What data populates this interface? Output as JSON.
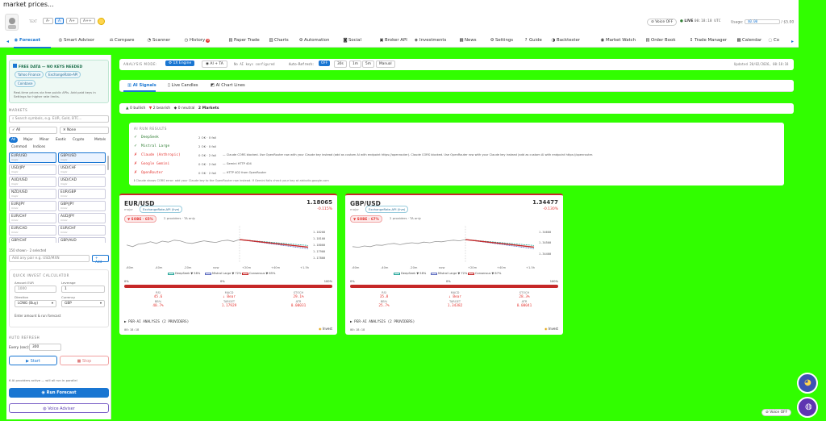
{
  "topbar": {
    "title": "market prices..."
  },
  "header": {
    "fs_label": "TEXT",
    "fs": [
      "A-",
      "A",
      "A+",
      "A++"
    ],
    "voice": "Voice OFF",
    "live": "LIVE",
    "clock": "00:18:18 UTC",
    "usage_label": "Usage:",
    "usage_value": "$0.00",
    "usage_limit": "/ $5.00"
  },
  "nav": {
    "tabs": [
      {
        "l": "Forecast",
        "i": "◉"
      },
      {
        "l": "Smart Advisor",
        "i": "◎"
      },
      {
        "l": "Compare",
        "i": "⚖"
      },
      {
        "l": "Scanner",
        "i": "◔"
      },
      {
        "l": "History",
        "i": "◷",
        "b": "0"
      },
      {
        "l": "Paper Trade",
        "i": "▤"
      },
      {
        "l": "Charts",
        "i": "▥"
      },
      {
        "l": "Automation",
        "i": "⚙"
      },
      {
        "l": "Social",
        "i": "◙"
      },
      {
        "l": "Broker API",
        "i": "▣"
      },
      {
        "l": "Investments",
        "i": "◈"
      },
      {
        "l": "News",
        "i": "▦"
      },
      {
        "l": "Settings",
        "i": "⚙"
      },
      {
        "l": "Guide",
        "i": "?"
      },
      {
        "l": "Backtester",
        "i": "◑"
      },
      {
        "l": "Market Watch",
        "i": "◉"
      },
      {
        "l": "Order Book",
        "i": "▤"
      },
      {
        "l": "Trade Manager",
        "i": "↕"
      },
      {
        "l": "Calendar",
        "i": "▦"
      },
      {
        "l": "Co",
        "i": "◌"
      }
    ]
  },
  "sidebar": {
    "free_title": "FREE DATA — NO KEYS NEEDED",
    "chips": [
      "Yahoo Finance",
      "ExchangeRate-API",
      "Coinbase"
    ],
    "free_note": "Real-time prices via free public APIs. Add paid keys in Settings for higher rate limits.",
    "markets_label": "MARKETS",
    "search_ph": "Search symbols, e.g. EUR, Gold, BTC...",
    "all": "All",
    "none": "None",
    "cats": [
      "All",
      "Major",
      "Minor",
      "Exotic",
      "Crypto",
      "Metals",
      "Commod",
      "Indices"
    ],
    "pairs": [
      [
        "EUR/USD",
        "major"
      ],
      [
        "GBP/USD",
        "major"
      ],
      [
        "USD/JPY",
        "major"
      ],
      [
        "USD/CHF",
        "major"
      ],
      [
        "AUD/USD",
        "major"
      ],
      [
        "USD/CAD",
        "major"
      ],
      [
        "NZD/USD",
        "major"
      ],
      [
        "EUR/GBP",
        "minor"
      ],
      [
        "EUR/JPY",
        "minor"
      ],
      [
        "GBP/JPY",
        "minor"
      ],
      [
        "EUR/CHF",
        "minor"
      ],
      [
        "AUD/JPY",
        "minor"
      ],
      [
        "EUR/CAD",
        "minor"
      ],
      [
        "EUR/CHF",
        "minor"
      ],
      [
        "GBP/CHF",
        "minor"
      ],
      [
        "GBP/AUD",
        "minor"
      ]
    ],
    "count": "150 shown · 2 selected",
    "add_ph": "Add any pair e.g. USD/MXN",
    "add_btn": "+ Add",
    "calc_label": "QUICK INVEST CALCULATOR",
    "amount_label": "Amount EUR",
    "amount": "1000",
    "lev_label": "Leverage",
    "lev": "1",
    "dir_label": "Direction",
    "dir": "LONG (Buy)",
    "cur_label": "Currency",
    "cur": "GBP",
    "calc_note": "Enter amount & run forecast",
    "auto_label": "AUTO REFRESH",
    "every_label": "Every (sec):",
    "every": "300",
    "start": "▶ Start",
    "stop": "■ Stop",
    "providers_note": "6 AI providers active — will all run in parallel",
    "run": "Run Forecast",
    "voice": "Voice Adviser"
  },
  "analysis": {
    "mode_label": "ANALYSIS MODE:",
    "mode1": "1X Engine",
    "mode2": "AI + TA",
    "keys": "No AI keys configured",
    "auto_label": "Auto-Refresh:",
    "opts": [
      "OFF",
      "30s",
      "1m",
      "5m",
      "Manual"
    ],
    "updated": "Updated 20/02/2026, 00:18:18"
  },
  "subtabs": [
    "AI Signals",
    "Live Candles",
    "AI Chart Lines"
  ],
  "sentiment": {
    "bull": "0 bullish",
    "bear": "2 bearish",
    "neutral": "0 neutral",
    "markets": "2 Markets"
  },
  "runs": {
    "title": "AI RUN RESULTS",
    "rows": [
      [
        "✓",
        "DeepSeek",
        "2 OK · 0 fail",
        ""
      ],
      [
        "✓",
        "Mistral Large",
        "2 OK · 0 fail",
        ""
      ],
      [
        "✗",
        "Claude (Anthropic)",
        "0 OK · 2 fail",
        "— Claude CORS blocked. Use OpenRouter row with your Claude key instead (add as custom AI with endpoint https://openrouter). Claude CORS blocked. Use OpenRouter row with your Claude key instead (add as custom AI with endpoint https://openrouter."
      ],
      [
        "✗",
        "Google Gemini",
        "0 OK · 2 fail",
        "— Gemini HTTP 404"
      ],
      [
        "✗",
        "OpenRouter",
        "0 OK · 2 fail",
        "— HTTP 402 from OpenRouter"
      ]
    ],
    "note": "Claude shows CORS error: add your Claude key to the OpenRouter row instead. If Gemini fails check your key at aistudio.google.com"
  },
  "cards": [
    {
      "pair": "EUR/USD",
      "price": "1.18065",
      "chg": "-0.115%",
      "tag": "ExchangeRate-API (live)",
      "signal": "▼ SOBE · 65%",
      "prov": "2 providers · TA only",
      "yt": [
        "1.18200",
        "1.18100",
        "1.18000",
        "1.17900",
        "1.17800"
      ],
      "xt": [
        "-60m",
        "-40m",
        "-20m",
        "now",
        "+20m",
        "+40m",
        "+1.5h"
      ],
      "legend": [
        "DeepSeek ▼ 58%",
        "Mistral Large ▼ 72%",
        "Consensus ▼ 65%"
      ],
      "lo": "0%",
      "mid": "0%",
      "hi": "100%",
      "stats": [
        [
          "RSI",
          "45.6"
        ],
        [
          "MACD",
          "↓ Bear"
        ],
        [
          "STOCH",
          "29.1%"
        ],
        [
          "BB%",
          "40.7%"
        ],
        [
          "TARGET",
          "1.17929"
        ],
        [
          "ATR",
          "0.00031"
        ]
      ],
      "per": "▶ PER-AI ANALYSIS (2 PROVIDERS)",
      "time": "00:18:18",
      "invest": "Invest",
      "pts": [
        0.55,
        0.6,
        0.52,
        0.5,
        0.45,
        0.5,
        0.43,
        0.46,
        0.4,
        0.42,
        0.48,
        0.5,
        0.46,
        0.42,
        0.45,
        0.47,
        0.42,
        0.4,
        0.44,
        0.38
      ],
      "fc": [
        0.38,
        0.28
      ]
    },
    {
      "pair": "GBP/USD",
      "price": "1.34477",
      "chg": "-0.130%",
      "tag": "ExchangeRate-API (live)",
      "signal": "▼ SOBE · 67%",
      "prov": "2 providers · TA only",
      "yt": [
        "1.34600",
        "1.34500",
        "1.34400"
      ],
      "xt": [
        "-60m",
        "-40m",
        "-20m",
        "now",
        "+20m",
        "+40m",
        "+1.5h"
      ],
      "legend": [
        "DeepSeek ▼ 58%",
        "Mistral Large ▼ 72%",
        "Consensus ▼ 67%"
      ],
      "lo": "0%",
      "mid": "0%",
      "hi": "100%",
      "stats": [
        [
          "RSI",
          "35.8"
        ],
        [
          "MACD",
          "↓ Bear"
        ],
        [
          "STOCH",
          "28.3%"
        ],
        [
          "BB%",
          "25.7%"
        ],
        [
          "TARGET",
          "1.34382"
        ],
        [
          "ATR",
          "0.00041"
        ]
      ],
      "per": "▶ PER-AI ANALYSIS (2 PROVIDERS)",
      "time": "00:18:18",
      "invest": "Invest",
      "pts": [
        0.6,
        0.62,
        0.58,
        0.6,
        0.55,
        0.56,
        0.52,
        0.5,
        0.54,
        0.5,
        0.48,
        0.5,
        0.46,
        0.48,
        0.44,
        0.45,
        0.42,
        0.4,
        0.42,
        0.38
      ],
      "fc": [
        0.38,
        0.26
      ]
    }
  ],
  "float": {
    "voice": "Voice OFF"
  }
}
